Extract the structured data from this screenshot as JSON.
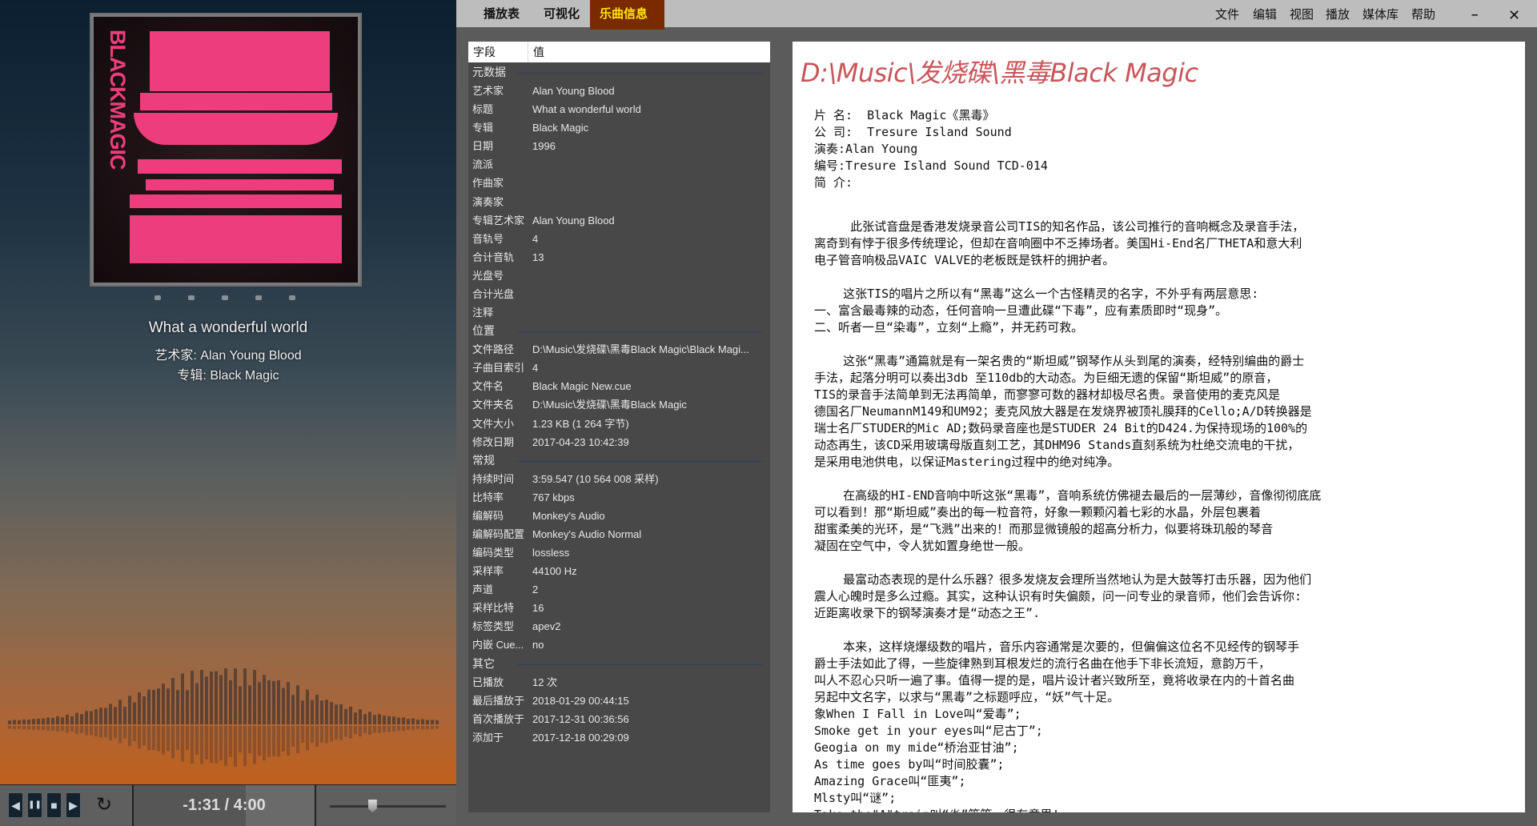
{
  "topbar": {
    "tabs": [
      "播放表",
      "可视化",
      "乐曲信息"
    ],
    "active_tab": 2,
    "menu": [
      "文件",
      "编辑",
      "视图",
      "播放",
      "媒体库",
      "帮助"
    ],
    "minimize": "–",
    "close": "✕"
  },
  "now_playing": {
    "title": "What a wonderful world",
    "artist_line": "艺术家:  Alan Young Blood",
    "album_line": "专辑:  Black Magic",
    "album_art_text": "BLACKMAGIC 黑毒"
  },
  "controls": {
    "prev": "◀",
    "pause": "❚❚",
    "stop": "■",
    "next": "▶",
    "repeat": "↻",
    "time": "-1:31 / 4:00",
    "volume": 0.33,
    "progress": 0.62
  },
  "props": {
    "header": {
      "field": "字段",
      "value": "值"
    },
    "rows": [
      {
        "k": "元数据",
        "sec": true
      },
      {
        "k": "艺术家",
        "v": "Alan Young Blood"
      },
      {
        "k": "标题",
        "v": "What a wonderful world"
      },
      {
        "k": "专辑",
        "v": "Black Magic"
      },
      {
        "k": "日期",
        "v": "1996"
      },
      {
        "k": "流派",
        "v": ""
      },
      {
        "k": "作曲家",
        "v": ""
      },
      {
        "k": "演奏家",
        "v": ""
      },
      {
        "k": "专辑艺术家",
        "v": "Alan Young Blood"
      },
      {
        "k": "音轨号",
        "v": "4"
      },
      {
        "k": "合计音轨",
        "v": "13"
      },
      {
        "k": "光盘号",
        "v": ""
      },
      {
        "k": "合计光盘",
        "v": ""
      },
      {
        "k": "注释",
        "v": ""
      },
      {
        "k": "位置",
        "sec": true
      },
      {
        "k": "文件路径",
        "v": "D:\\Music\\发烧碟\\黑毒Black Magic\\Black Magi..."
      },
      {
        "k": "子曲目索引",
        "v": "4"
      },
      {
        "k": "文件名",
        "v": "Black Magic New.cue"
      },
      {
        "k": "文件夹名",
        "v": "D:\\Music\\发烧碟\\黑毒Black Magic"
      },
      {
        "k": "文件大小",
        "v": "1.23 KB (1 264 字节)"
      },
      {
        "k": "修改日期",
        "v": "2017-04-23 10:42:39"
      },
      {
        "k": "常规",
        "sec": true
      },
      {
        "k": "持续时间",
        "v": "3:59.547 (10 564 008 采样)"
      },
      {
        "k": "比特率",
        "v": "767 kbps"
      },
      {
        "k": "编解码",
        "v": "Monkey's Audio"
      },
      {
        "k": "编解码配置",
        "v": "Monkey's Audio Normal"
      },
      {
        "k": "编码类型",
        "v": "lossless"
      },
      {
        "k": "采样率",
        "v": "44100 Hz"
      },
      {
        "k": "声道",
        "v": "2"
      },
      {
        "k": "采样比特",
        "v": "16"
      },
      {
        "k": "标签类型",
        "v": "apev2"
      },
      {
        "k": "内嵌 Cue...",
        "v": "no"
      },
      {
        "k": "其它",
        "sec": true
      },
      {
        "k": "已播放",
        "v": "12 次"
      },
      {
        "k": "最后播放于",
        "v": "2018-01-29 00:44:15"
      },
      {
        "k": "首次播放于",
        "v": "2017-12-31 00:36:56"
      },
      {
        "k": "添加于",
        "v": "2017-12-18 00:29:09"
      }
    ]
  },
  "info": {
    "title": "D:\\Music\\发烧碟\\黑毒Black Magic",
    "lines": [
      "片 名:  Black Magic《黑毒》",
      "公 司:  Tresure Island Sound",
      "演奏:Alan Young",
      "编号:Tresure Island Sound TCD-014",
      "简 介:",
      "",
      "     此张试音盘是香港发烧录音公司TIS的知名作品，该公司推行的音响概念及录音手法，",
      "离奇到有悖于很多传统理论，但却在音响圈中不乏捧场者。美国Hi-End名厂THETA和意大利",
      "电子管音响极品VAIC VALVE的老板既是铁杆的拥护者。",
      "",
      "    这张TIS的唱片之所以有“黑毒”这么一个古怪精灵的名字，不外乎有两层意思:",
      "一、富含最毒辣的动态，任何音响一旦遭此碟“下毒”，应有素质即时“现身”。",
      "二、听者一旦“染毒”，立刻“上瘾”，并无药可救。",
      "",
      "    这张“黑毒”通篇就是有一架名贵的“斯坦威”钢琴作从头到尾的演奏，经特别编曲的爵士",
      "手法，起落分明可以奏出3db 至110db的大动态。为巨细无遗的保留“斯坦威”的原音，",
      "TIS的录音手法简单到无法再简单，而寥寥可数的器材却极尽名贵。录音使用的麦克风是",
      "德国名厂NeumannM149和UM92；麦克风放大器是在发烧界被顶礼膜拜的Cello;A/D转换器是",
      "瑞士名厂STUDER的Mic AD;数码录音座也是STUDER 24 Bit的D424.为保持现场的100%的",
      "动态再生，该CD采用玻璃母版直刻工艺，其DHM96 Stands直刻系统为杜绝交流电的干扰，",
      "是采用电池供电，以保证Mastering过程中的绝对纯净。",
      "",
      "    在高级的HI-END音响中听这张“黑毒”，音响系统仿佛褪去最后的一层薄纱，音像彻彻底底",
      "可以看到！那“斯坦威”奏出的每一粒音符，好象一颗颗闪着七彩的水晶，外层包裹着",
      "甜蜜柔美的光环，是“飞溅”出来的！而那显微镜般的超高分析力，似要将珠玑般的琴音",
      "凝固在空气中，令人犹如置身绝世一般。",
      "",
      "    最富动态表现的是什么乐器？很多发烧友会理所当然地认为是大鼓等打击乐器，因为他们",
      "震人心魄时是多么过瘾。其实，这种认识有时失偏颇，问一问专业的录音师，他们会告诉你:",
      "近距离收录下的钢琴演奏才是“动态之王”.",
      "",
      "    本来，这样烧爆级数的唱片，音乐内容通常是次要的，但偏偏这位名不见经传的钢琴手",
      "爵士手法如此了得，一些旋律熟到耳根发烂的流行名曲在他手下非长流短，意韵万千，",
      "叫人不忍心只听一遍了事。值得一提的是，唱片设计者兴致所至，竟将收录在内的十首名曲",
      "另起中文名字，以求与“黑毒”之标题呼应，“妖”气十足。",
      "象When I Fall in Love叫“爱毒”;",
      "Smoke get in your eyes叫“尼古丁”;",
      "Geogia on my mide“桥治亚甘油”;",
      "As time goes by叫“时间胶囊”;",
      "Amazing Grace叫“匪夷”;",
      "Mlsty叫“谜”;",
      "Take the\"A\"train叫“炎”等等，很有意思!"
    ]
  }
}
